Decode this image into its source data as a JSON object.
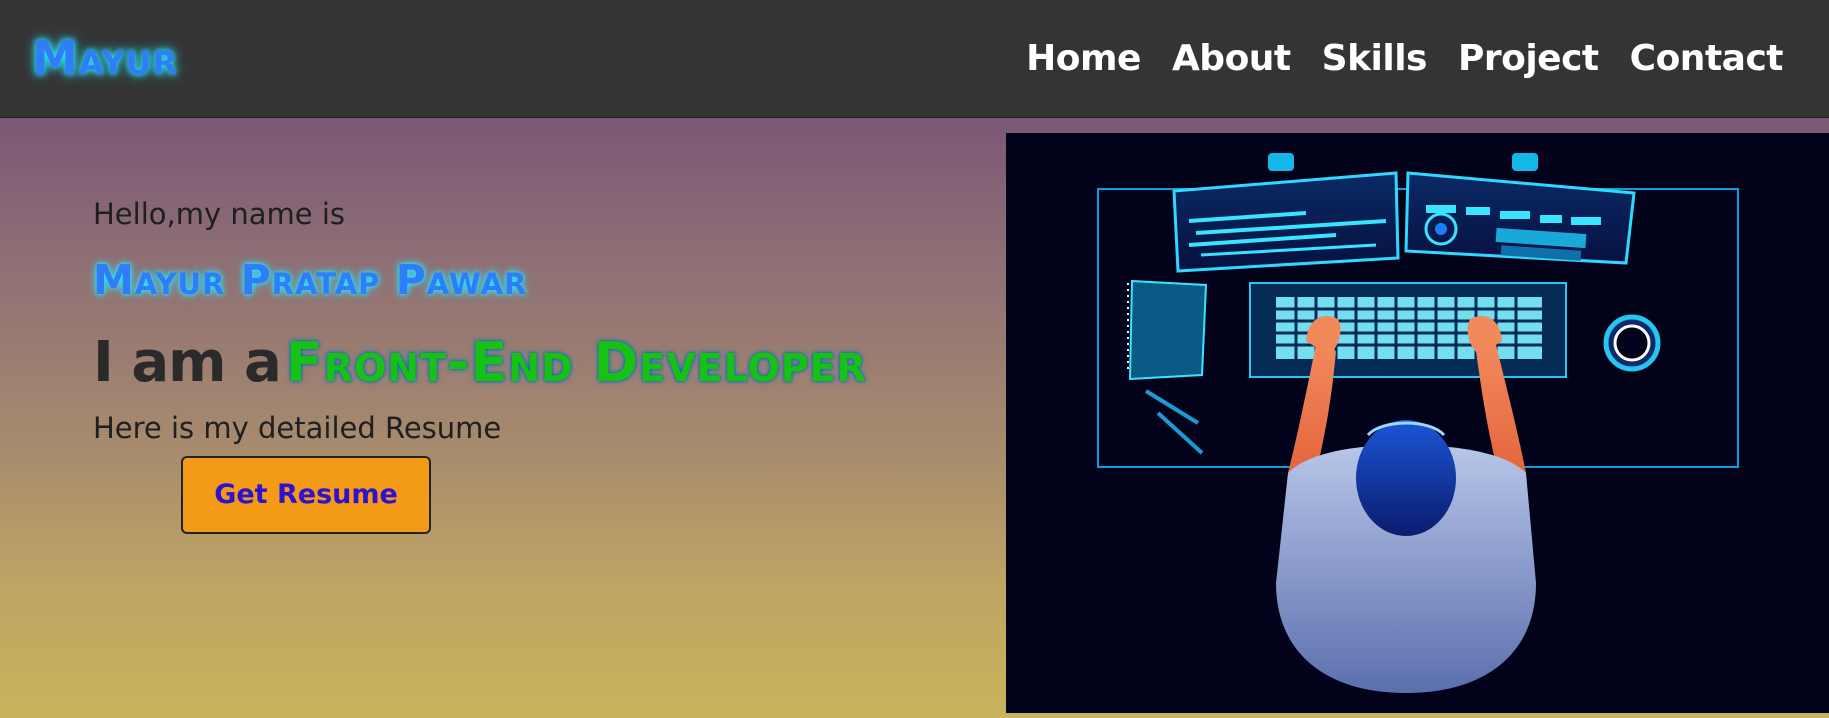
{
  "navbar": {
    "brand": "Mayur",
    "links": [
      "Home",
      "About",
      "Skills",
      "Project",
      "Contact"
    ]
  },
  "hero": {
    "greeting": "Hello,my name is",
    "full_name": "Mayur Pratap Pawar",
    "role_prefix": "I am a",
    "role_title": "Front-End Developer",
    "resume_text": "Here is my detailed Resume",
    "resume_button": "Get Resume",
    "illustration_icon": "developer-at-desk-illustration"
  },
  "colors": {
    "navbar_bg": "#343434",
    "brand_text": "#2f7df7",
    "brand_glow": "#29e7ff",
    "role_title": "#17c217",
    "button_bg": "#f39a16",
    "button_text": "#2d12d4",
    "gradient_top": "#7a5876",
    "gradient_bottom": "#c8b35b"
  }
}
